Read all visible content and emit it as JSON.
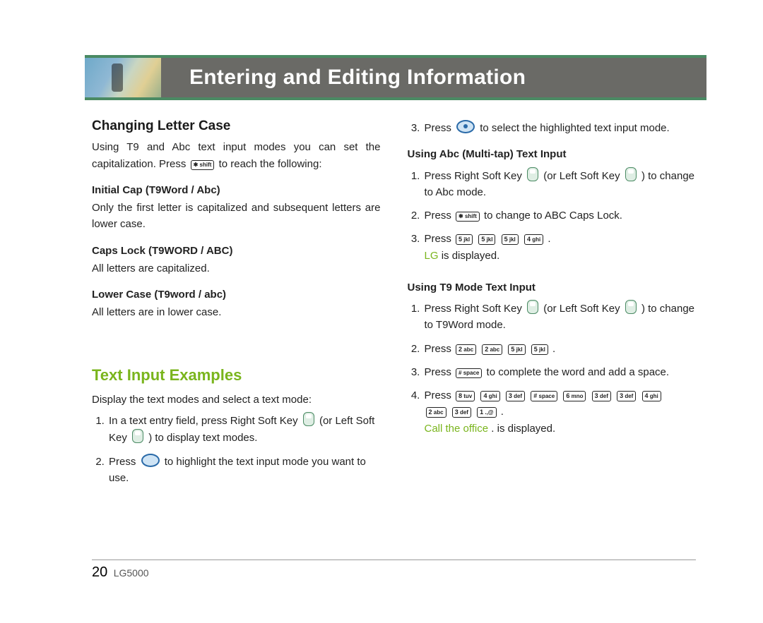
{
  "header": {
    "title": "Entering and Editing Information"
  },
  "left": {
    "section1": {
      "title": "Changing Letter Case",
      "intro_a": "Using T9 and Abc text input modes you can set the capitalization. Press ",
      "intro_key": "✱ shift",
      "intro_b": " to reach the following:",
      "sub1": {
        "title": "Initial Cap (T9Word / Abc)",
        "body": "Only the first letter is capitalized and subsequent letters are lower case."
      },
      "sub2": {
        "title": "Caps Lock (T9WORD / ABC)",
        "body": "All letters are capitalized."
      },
      "sub3": {
        "title": "Lower Case (T9word / abc)",
        "body": "All letters are in lower case."
      }
    },
    "section2": {
      "title": "Text Input Examples",
      "intro": "Display the text modes and select a text mode:",
      "step1_a": "In a text entry field, press Right Soft Key ",
      "step1_b": " (or Left Soft Key ",
      "step1_c": " ) to display text modes.",
      "step2_a": "Press ",
      "step2_b": " to highlight the text input mode you want to use."
    }
  },
  "right": {
    "step3_a": "Press ",
    "step3_b": " to select the highlighted text input mode.",
    "sectionA": {
      "title": "Using Abc (Multi-tap) Text Input",
      "s1_a": "Press Right Soft Key ",
      "s1_b": " (or Left Soft Key ",
      "s1_c": " ) to change to Abc mode.",
      "s2_a": "Press ",
      "s2_key": "✱ shift",
      "s2_b": " to change to ABC Caps Lock.",
      "s3_a": "Press ",
      "s3_keys": [
        "5 jkl",
        "5 jkl",
        "5 jkl",
        "4 ghi"
      ],
      "s3_b": ".",
      "s3_highlight": "LG",
      "s3_c": " is displayed."
    },
    "sectionB": {
      "title": "Using T9 Mode Text Input",
      "s1_a": "Press Right Soft Key ",
      "s1_b": " (or Left Soft Key ",
      "s1_c": " ) to change to T9Word mode.",
      "s2_a": "Press ",
      "s2_keys": [
        "2 abc",
        "2 abc",
        "5 jkl",
        "5 jkl"
      ],
      "s2_b": ".",
      "s3_a": "Press ",
      "s3_key": "# space",
      "s3_b": " to complete the word and add a space.",
      "s4_a": "Press ",
      "s4_keys_line1": [
        "8 tuv",
        "4 ghi",
        "3 def",
        "# space",
        "6 mno",
        "3 def",
        "3 def",
        "4 ghi"
      ],
      "s4_keys_line2": [
        "2 abc",
        "3 def",
        "1 .,@"
      ],
      "s4_b": ".",
      "s4_highlight": "Call the office",
      "s4_c": ". is displayed."
    }
  },
  "footer": {
    "page": "20",
    "model": "LG5000"
  }
}
